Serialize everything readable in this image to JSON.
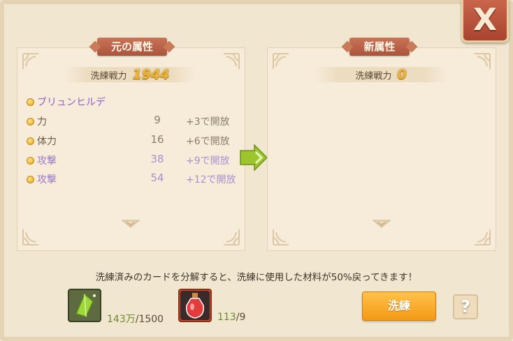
{
  "close": {
    "label": "X"
  },
  "left_panel": {
    "title": "元の属性",
    "power_label": "洗練戦力",
    "power_value": "1944",
    "hero_name": "ブリュンヒルデ",
    "stats": [
      {
        "name": "力",
        "value": "9",
        "unlock": "+3で開放",
        "locked": false
      },
      {
        "name": "体力",
        "value": "16",
        "unlock": "+6で開放",
        "locked": false
      },
      {
        "name": "攻撃",
        "value": "38",
        "unlock": "+9で開放",
        "locked": true
      },
      {
        "name": "攻撃",
        "value": "54",
        "unlock": "+12で開放",
        "locked": true
      }
    ]
  },
  "right_panel": {
    "title": "新属性",
    "power_label": "洗練戦力",
    "power_value": "0"
  },
  "notice": "洗練済みのカードを分解すると、洗練に使用した材料が50%戻ってきます！",
  "materials": [
    {
      "icon": "green-crystal-icon",
      "have": "143万",
      "need": "/1500"
    },
    {
      "icon": "red-potion-icon",
      "have": "113",
      "need": "/9"
    }
  ],
  "buttons": {
    "wash": "洗練",
    "help": "?"
  },
  "colors": {
    "accent": "#f39a16",
    "ribbon": "#b95c42",
    "locked_stat": "#a98fd0"
  }
}
